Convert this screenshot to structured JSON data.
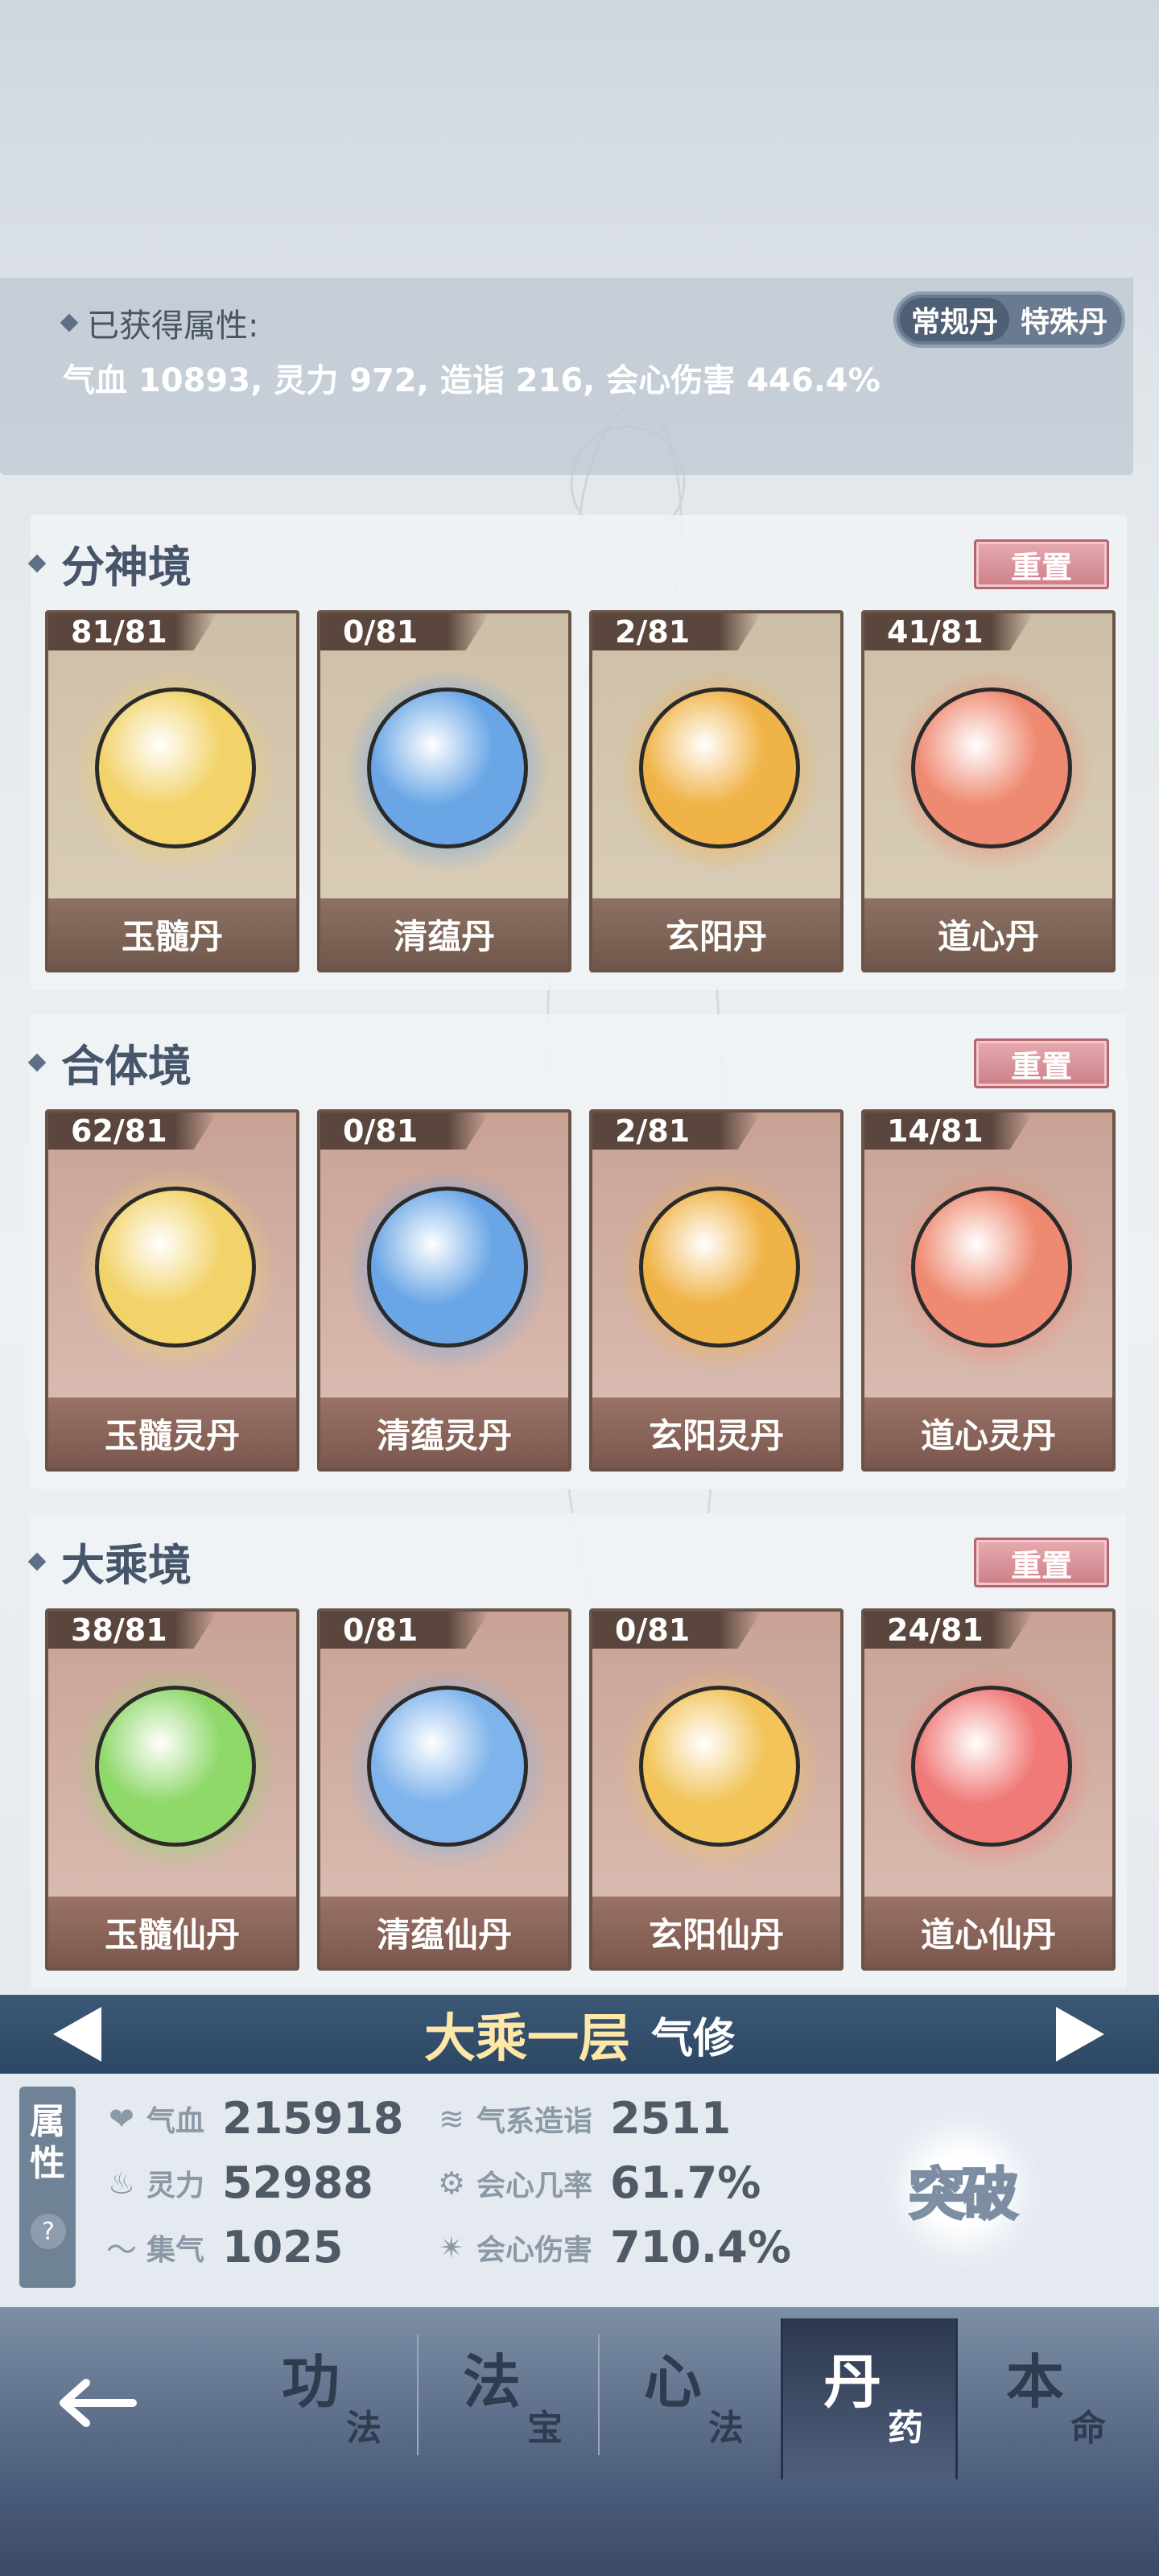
{
  "attributes": {
    "title": "已获得属性:",
    "summary": "气血 10893, 灵力 972, 造诣 216, 会心伤害 446.4%",
    "switch": [
      "常规丹",
      "特殊丹"
    ]
  },
  "sections": [
    {
      "title": "分神境",
      "reset_label": "重置",
      "cards": [
        {
          "count": "81/81",
          "name": "玉髓丹",
          "color": "#f2d36a"
        },
        {
          "count": "0/81",
          "name": "清蕴丹",
          "color": "#6aa6e6"
        },
        {
          "count": "2/81",
          "name": "玄阳丹",
          "color": "#f0b347"
        },
        {
          "count": "41/81",
          "name": "道心丹",
          "color": "#ef8a72"
        }
      ]
    },
    {
      "title": "合体境",
      "reset_label": "重置",
      "cards": [
        {
          "count": "62/81",
          "name": "玉髓灵丹",
          "color": "#f2d36a"
        },
        {
          "count": "0/81",
          "name": "清蕴灵丹",
          "color": "#6aa6e6"
        },
        {
          "count": "2/81",
          "name": "玄阳灵丹",
          "color": "#f0b347"
        },
        {
          "count": "14/81",
          "name": "道心灵丹",
          "color": "#ef8a72"
        }
      ]
    },
    {
      "title": "大乘境",
      "reset_label": "重置",
      "cards": [
        {
          "count": "38/81",
          "name": "玉髓仙丹",
          "color": "#8fd86a"
        },
        {
          "count": "0/81",
          "name": "清蕴仙丹",
          "color": "#7eb3ec"
        },
        {
          "count": "0/81",
          "name": "玄阳仙丹",
          "color": "#f2c45a"
        },
        {
          "count": "24/81",
          "name": "道心仙丹",
          "color": "#f07a78"
        }
      ]
    }
  ],
  "realm": {
    "name": "大乘一层",
    "type": "气修"
  },
  "stats": {
    "tab_label": [
      "属",
      "性"
    ],
    "help": "?",
    "items": [
      {
        "label": "气血",
        "value": "215918",
        "icon": "heart-icon"
      },
      {
        "label": "灵力",
        "value": "52988",
        "icon": "flame-icon"
      },
      {
        "label": "集气",
        "value": "1025",
        "icon": "swirl-icon"
      },
      {
        "label": "气系造诣",
        "value": "2511",
        "icon": "wind-icon"
      },
      {
        "label": "会心几率",
        "value": "61.7%",
        "icon": "crit-rate-icon"
      },
      {
        "label": "会心伤害",
        "value": "710.4%",
        "icon": "crit-damage-icon"
      }
    ],
    "breakthrough": "突破"
  },
  "nav": [
    {
      "big": "功",
      "small": "法"
    },
    {
      "big": "法",
      "small": "宝"
    },
    {
      "big": "心",
      "small": "法"
    },
    {
      "big": "丹",
      "small": "药"
    },
    {
      "big": "本",
      "small": "命"
    }
  ]
}
